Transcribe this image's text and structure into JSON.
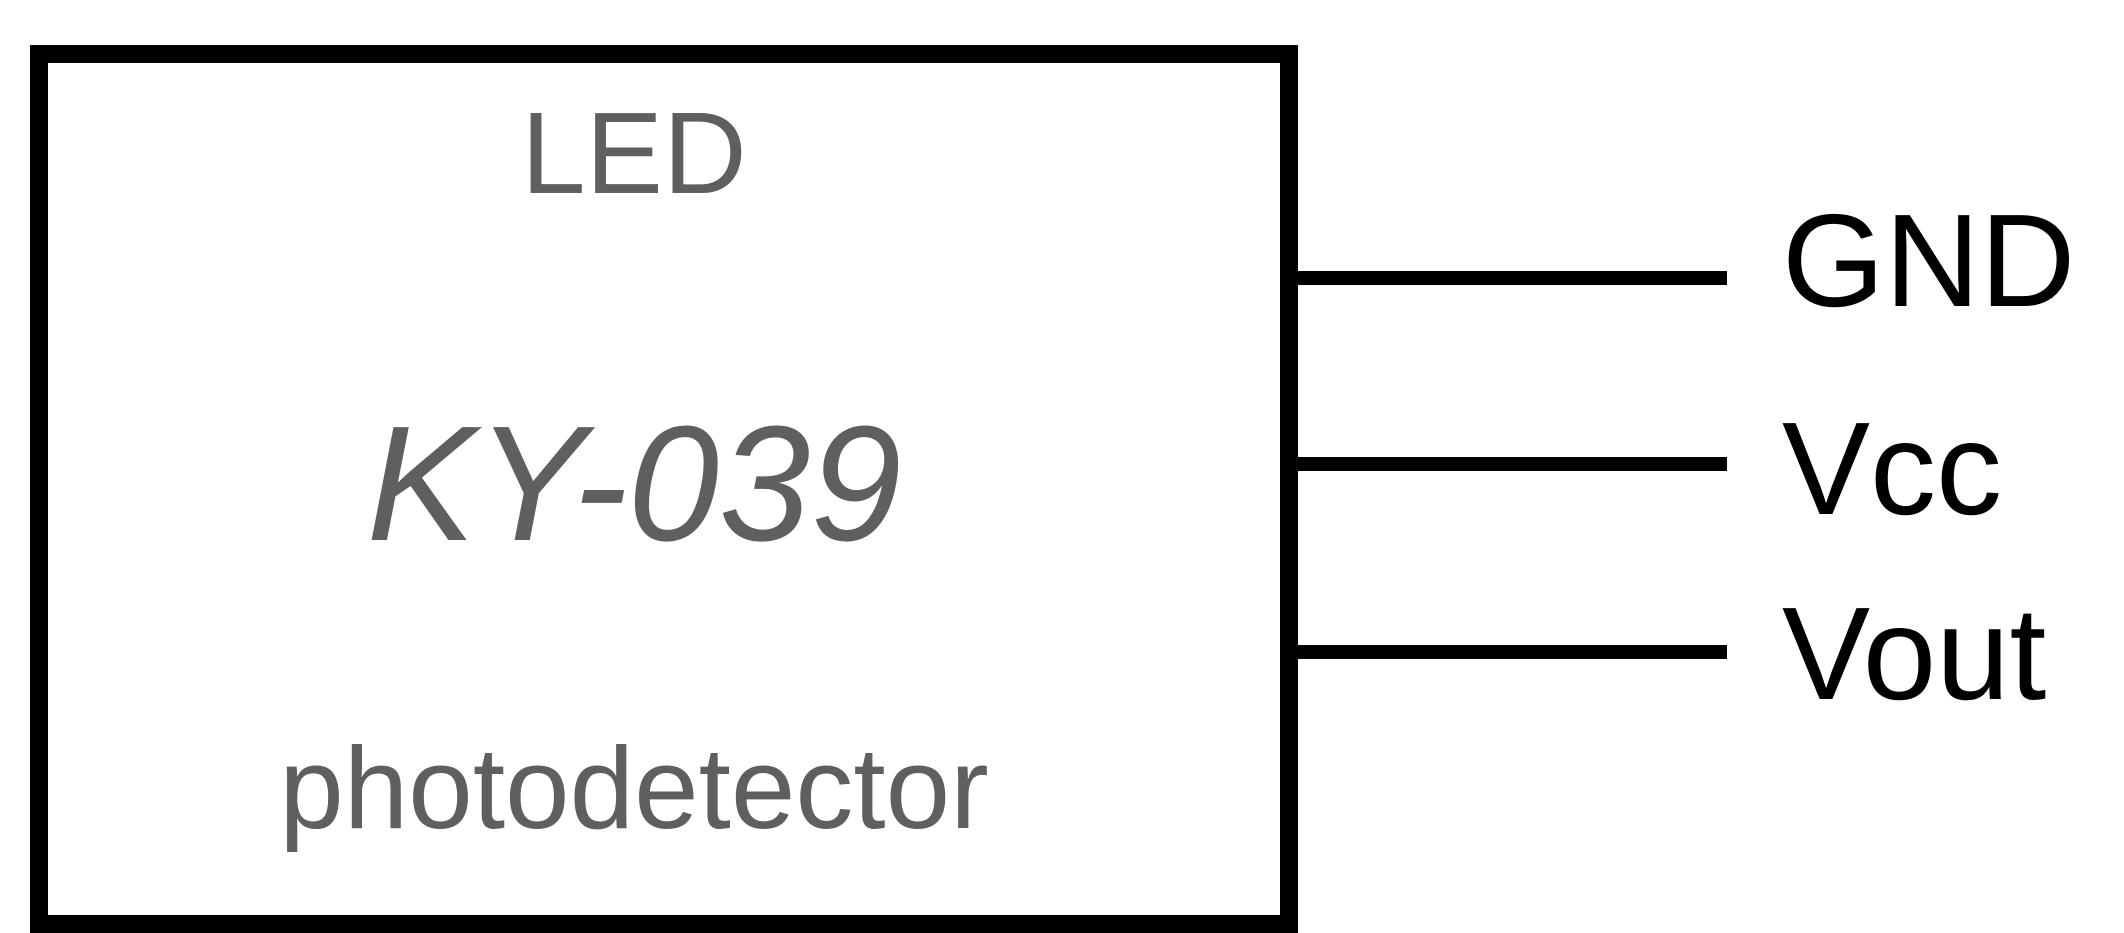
{
  "module": {
    "top_label": "LED",
    "model": "KY-039",
    "bottom_label": "photodetector"
  },
  "pins": [
    {
      "label": "GND"
    },
    {
      "label": "Vcc"
    },
    {
      "label": "Vout"
    }
  ],
  "colors": {
    "outline": "#000000",
    "module_text": "#5f5f5f",
    "pin_text": "#000000",
    "background": "#ffffff"
  }
}
